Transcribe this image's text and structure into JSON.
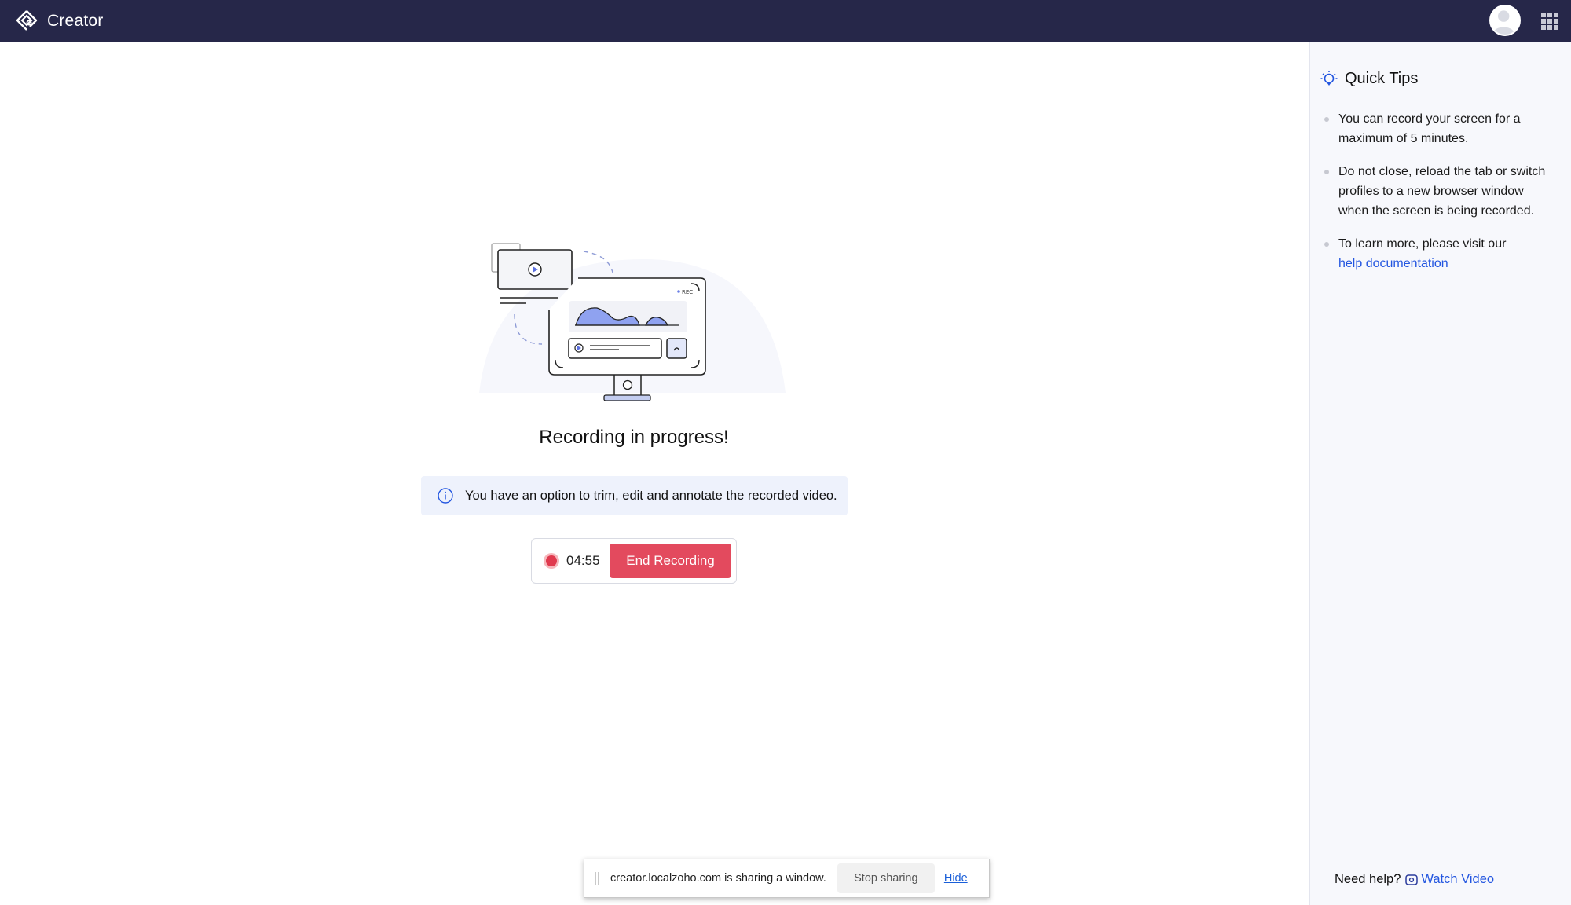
{
  "app": {
    "title": "Creator",
    "colors": {
      "header_bg": "#262749",
      "accent": "#2356e0",
      "danger": "#e34a5e",
      "info_bg": "#eef2fc"
    }
  },
  "header": {
    "brand_label": "Creator",
    "avatar_icon": "user-avatar-icon",
    "apps_icon": "grid-apps-icon"
  },
  "main": {
    "illustration": {
      "rec_label": "REC"
    },
    "heading": "Recording in progress!",
    "info_text": "You have an option to trim, edit and annotate the recorded video.",
    "timer": "04:55",
    "end_button_label": "End Recording"
  },
  "sidebar": {
    "title": "Quick Tips",
    "tips": [
      "You can record your screen for a maximum of 5 minutes.",
      "Do not close, reload the tab or switch profiles to a new browser window when the screen is being recorded.",
      "To learn more, please visit our"
    ],
    "help_link": "help documentation",
    "need_help_label": "Need help?",
    "watch_video_label": "Watch Video"
  },
  "share_bar": {
    "message": "creator.localzoho.com is sharing a window.",
    "stop_label": "Stop sharing",
    "hide_label": "Hide"
  }
}
